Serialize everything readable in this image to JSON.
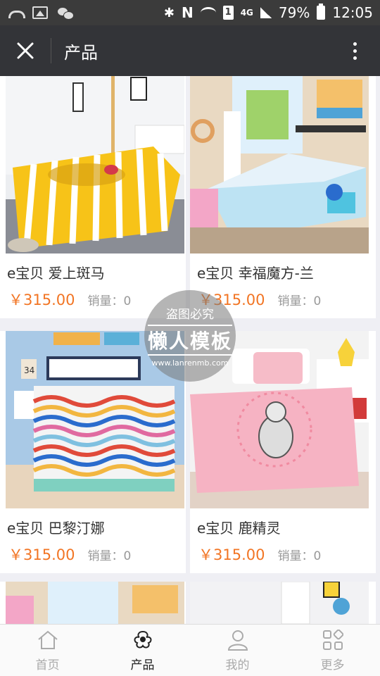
{
  "status_bar": {
    "network": "4G",
    "sim": "1",
    "battery": "79%",
    "time": "12:05"
  },
  "header": {
    "title": "产品",
    "close_icon": "close-icon",
    "more_icon": "more-vertical-icon"
  },
  "products": [
    {
      "name": "e宝贝 爱上斑马",
      "price": "￥315.00",
      "sales": "销量：0"
    },
    {
      "name": "e宝贝 幸福魔方-兰",
      "price": "￥315.00",
      "sales": "销量：0"
    },
    {
      "name": "e宝贝 巴黎汀娜",
      "price": "￥315.00",
      "sales": "销量：0"
    },
    {
      "name": "e宝贝 鹿精灵",
      "price": "￥315.00",
      "sales": "销量：0"
    }
  ],
  "watermark": {
    "line1": "盗图必究",
    "line2": "懒人模板",
    "line3": "www.lanrenmb.com"
  },
  "tabbar": {
    "items": [
      {
        "label": "首页",
        "icon": "home-icon"
      },
      {
        "label": "产品",
        "icon": "cotton-flower-icon"
      },
      {
        "label": "我的",
        "icon": "user-icon"
      },
      {
        "label": "更多",
        "icon": "grid-icon"
      }
    ],
    "active_index": 1
  },
  "colors": {
    "accent_price": "#f27524",
    "titlebar_bg": "#333438"
  }
}
